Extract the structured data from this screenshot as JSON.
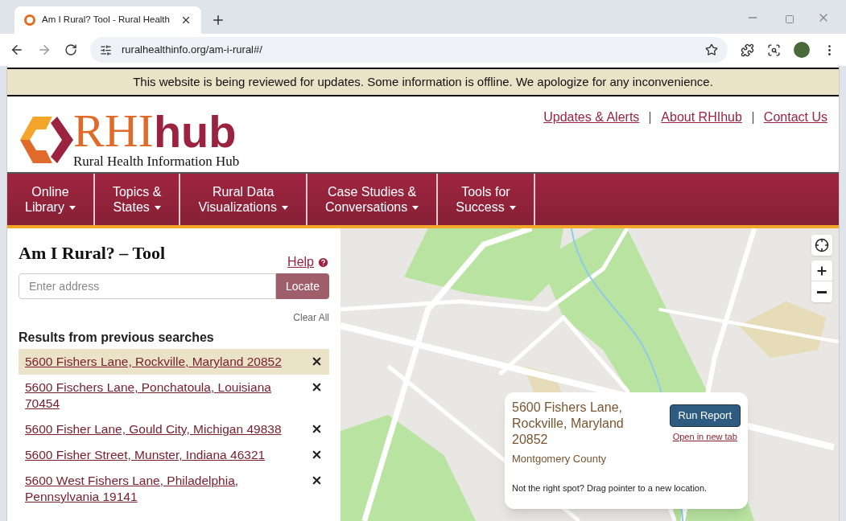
{
  "browser": {
    "tab_title": "Am I Rural? Tool - Rural Health",
    "url": "ruralhealthinfo.org/am-i-rural#/"
  },
  "banner": "This website is being reviewed for updates. Some information is offline. We apologize for any inconvenience.",
  "header": {
    "logo_rhi": "RHI",
    "logo_hub": "hub",
    "logo_tagline": "Rural Health Information Hub",
    "links": [
      "Updates & Alerts",
      "About RHIhub",
      "Contact Us"
    ]
  },
  "nav": [
    {
      "lines": [
        "Online",
        "Library"
      ]
    },
    {
      "lines": [
        "Topics &",
        "States"
      ]
    },
    {
      "lines": [
        "Rural Data",
        "Visualizations"
      ]
    },
    {
      "lines": [
        "Case Studies &",
        "Conversations"
      ]
    },
    {
      "lines": [
        "Tools for",
        "Success"
      ]
    }
  ],
  "tool": {
    "title": "Am I Rural? – Tool",
    "help": "Help",
    "placeholder": "Enter address",
    "locate": "Locate",
    "clear_all": "Clear All",
    "results_heading": "Results from previous searches",
    "results": [
      {
        "text": "5600 Fishers Lane, Rockville, Maryland 20852",
        "selected": true
      },
      {
        "text": "5600 Fischers Lane, Ponchatoula, Louisiana 70454",
        "selected": false
      },
      {
        "text": "5600 Fisher Lane, Gould City, Michigan 49838",
        "selected": false
      },
      {
        "text": "5600 Fisher Street, Munster, Indiana 46321",
        "selected": false
      },
      {
        "text": "5600 West Fishers Lane, Philadelphia, Pennsylvania 19141",
        "selected": false
      }
    ]
  },
  "popup": {
    "address": "5600 Fishers Lane, Rockville, Maryland 20852",
    "county": "Montgomery County",
    "run_report": "Run Report",
    "open_new_tab": "Open in new tab",
    "hint": "Not the right spot? Drag pointer to a new location."
  }
}
